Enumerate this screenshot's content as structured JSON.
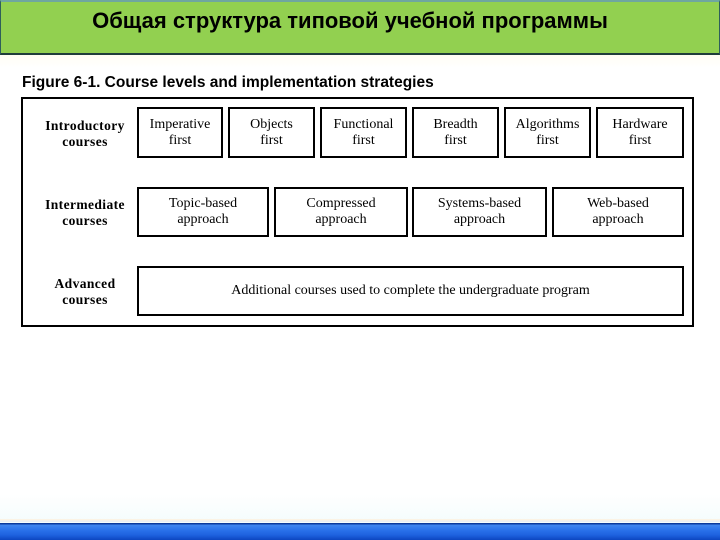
{
  "slide": {
    "title": "Общая структура типовой учебной программы",
    "header_color": "#92d050",
    "bottom_bar_color": "#1e62df"
  },
  "figure": {
    "caption": "Figure 6-1. Course levels and implementation strategies",
    "levels": [
      {
        "label": "Introductory\ncourses",
        "label_line1": "Introductory",
        "label_line2": "courses",
        "strategies": [
          {
            "line1": "Imperative",
            "line2": "first"
          },
          {
            "line1": "Objects",
            "line2": "first"
          },
          {
            "line1": "Functional",
            "line2": "first"
          },
          {
            "line1": "Breadth",
            "line2": "first"
          },
          {
            "line1": "Algorithms",
            "line2": "first"
          },
          {
            "line1": "Hardware",
            "line2": "first"
          }
        ]
      },
      {
        "label_line1": "Intermediate",
        "label_line2": "courses",
        "strategies": [
          {
            "line1": "Topic-based",
            "line2": "approach"
          },
          {
            "line1": "Compressed",
            "line2": "approach"
          },
          {
            "line1": "Systems-based",
            "line2": "approach"
          },
          {
            "line1": "Web-based",
            "line2": "approach"
          }
        ]
      },
      {
        "label_line1": "Advanced",
        "label_line2": "courses",
        "strategies": [
          {
            "line1": "Additional courses used to complete the undergraduate program",
            "line2": ""
          }
        ]
      }
    ]
  }
}
